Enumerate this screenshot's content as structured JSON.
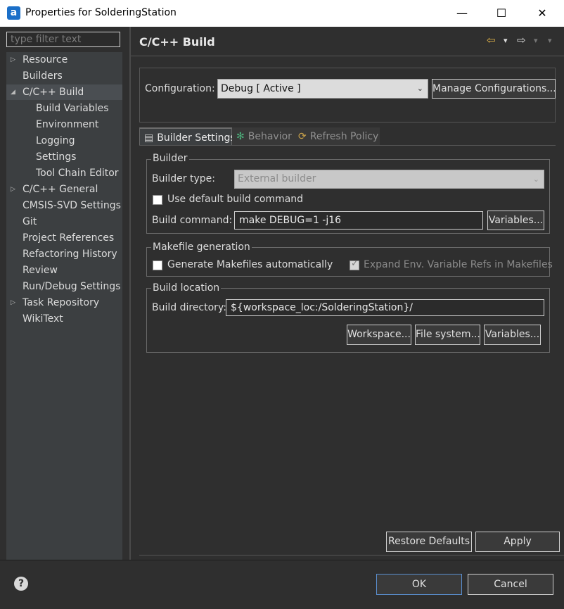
{
  "window": {
    "title": "Properties for SolderingStation",
    "app_icon": "a",
    "minimize_glyph": "—",
    "maximize_glyph": "☐",
    "close_glyph": "✕"
  },
  "filter": {
    "placeholder": "type filter text"
  },
  "tree": [
    {
      "label": "Resource",
      "level": 0,
      "twisty": "closed"
    },
    {
      "label": "Builders",
      "level": 0
    },
    {
      "label": "C/C++ Build",
      "level": 0,
      "twisty": "open",
      "selected": true
    },
    {
      "label": "Build Variables",
      "level": 1
    },
    {
      "label": "Environment",
      "level": 1
    },
    {
      "label": "Logging",
      "level": 1
    },
    {
      "label": "Settings",
      "level": 1
    },
    {
      "label": "Tool Chain Editor",
      "level": 1
    },
    {
      "label": "C/C++ General",
      "level": 0,
      "twisty": "closed"
    },
    {
      "label": "CMSIS-SVD Settings",
      "level": 0
    },
    {
      "label": "Git",
      "level": 0
    },
    {
      "label": "Project References",
      "level": 0
    },
    {
      "label": "Refactoring History",
      "level": 0
    },
    {
      "label": "Review",
      "level": 0
    },
    {
      "label": "Run/Debug Settings",
      "level": 0
    },
    {
      "label": "Task Repository",
      "level": 0,
      "twisty": "closed"
    },
    {
      "label": "WikiText",
      "level": 0
    }
  ],
  "page": {
    "title": "C/C++ Build",
    "nav": {
      "back": "⇦",
      "forward": "⇨",
      "menu": "▾"
    }
  },
  "configuration": {
    "label": "Configuration:",
    "value": "Debug  [ Active ]",
    "manage_button": "Manage Configurations..."
  },
  "tabs": [
    {
      "label": "Builder Settings",
      "icon": "builder-settings-icon",
      "active": true
    },
    {
      "label": "Behavior",
      "icon": "behavior-icon",
      "active": false
    },
    {
      "label": "Refresh Policy",
      "icon": "refresh-policy-icon",
      "active": false
    }
  ],
  "builder": {
    "group_label": "Builder",
    "type_label": "Builder type:",
    "type_value": "External builder",
    "use_default_label": "Use default build command",
    "use_default_checked": false,
    "command_label": "Build command:",
    "command_value": "make DEBUG=1 -j16",
    "variables_button": "Variables..."
  },
  "makefile": {
    "group_label": "Makefile generation",
    "generate_label": "Generate Makefiles automatically",
    "generate_checked": false,
    "expand_label": "Expand Env. Variable Refs in Makefiles",
    "expand_checked": true
  },
  "location": {
    "group_label": "Build location",
    "dir_label": "Build directory:",
    "dir_value": "${workspace_loc:/SolderingStation}/",
    "workspace_button": "Workspace...",
    "filesystem_button": "File system...",
    "variables_button": "Variables..."
  },
  "actions": {
    "restore_defaults": "Restore Defaults",
    "apply": "Apply",
    "ok": "OK",
    "cancel": "Cancel",
    "help": "?"
  }
}
